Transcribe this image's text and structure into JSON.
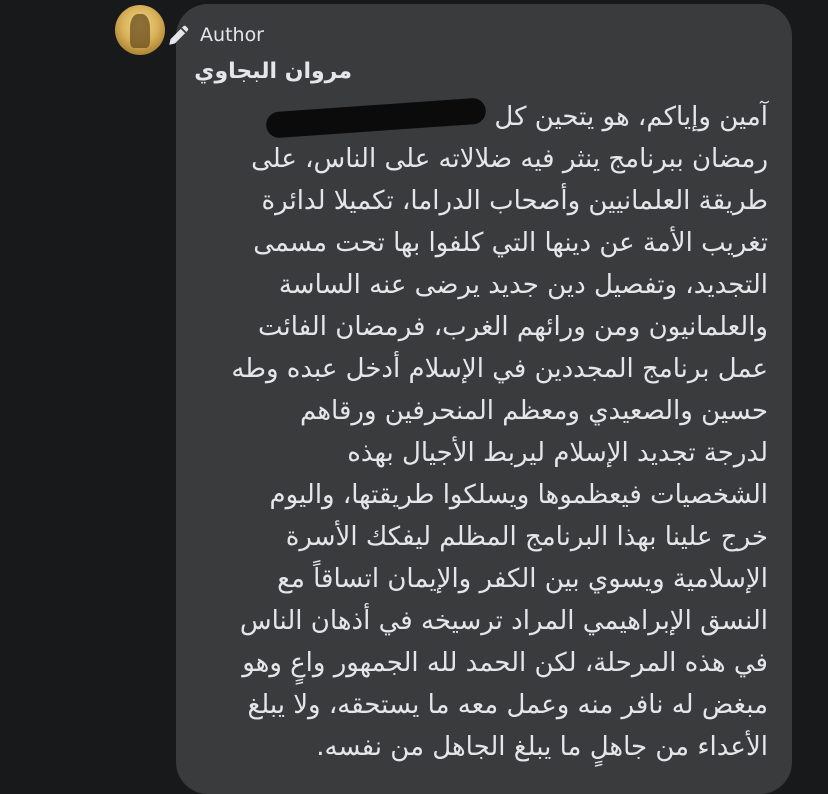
{
  "comment": {
    "badge_label": "Author",
    "author_name": "مروان البجاوي",
    "lines": [
      "آمين وإياكم، هو يتحين كل",
      "رمضان ببرنامج ينثر فيه ضلالاته على الناس، على",
      "طريقة العلمانيين وأصحاب الدراما، تكميلا لدائرة",
      "تغريب الأمة عن دينها التي كلفوا بها تحت مسمى",
      "التجديد، وتفصيل دين جديد يرضى عنه الساسة",
      "والعلمانيون ومن ورائهم الغرب، فرمضان الفائت",
      "عمل برنامج المجددين في الإسلام أدخل عبده وطه",
      "حسين والصعيدي ومعظم المنحرفين ورقاهم",
      "لدرجة تجديد الإسلام ليربط الأجيال بهذه",
      "الشخصيات فيعظموها ويسلكوا طريقتها، واليوم",
      "خرج علينا بهذا البرنامج المظلم ليفكك الأسرة",
      "الإسلامية ويسوي بين الكفر والإيمان اتساقاً مع",
      "النسق الإبراهيمي المراد ترسيخه في أذهان الناس",
      "في هذه المرحلة، لكن الحمد لله الجمهور واعٍ وهو",
      "مبغض له نافر منه وعمل معه ما يستحقه، ولا يبلغ",
      "الأعداء من جاهلٍ ما يبلغ الجاهل من نفسه."
    ]
  },
  "icons": {
    "badge_icon": "pencil-icon"
  },
  "colors": {
    "background": "#18191a",
    "bubble": "#3a3b3c",
    "text": "#e4e6eb"
  }
}
